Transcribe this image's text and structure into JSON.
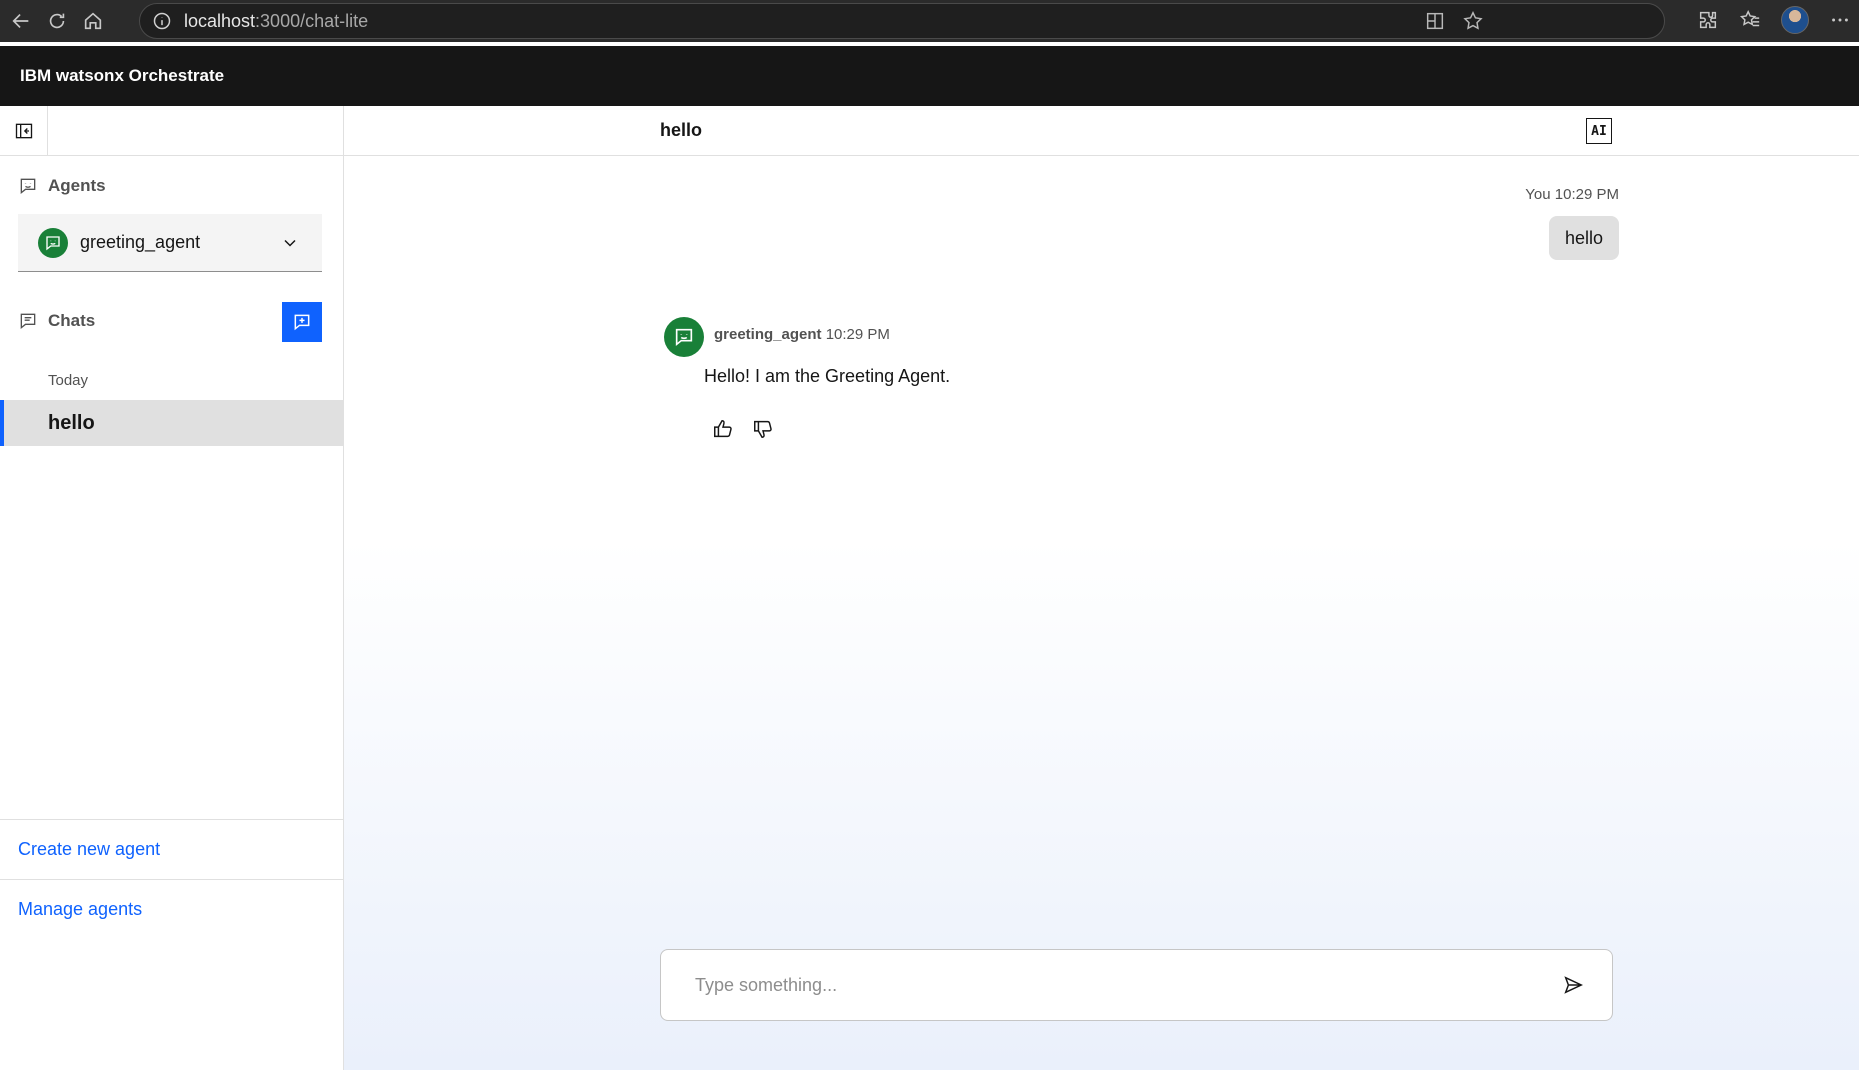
{
  "browser": {
    "url_host": "localhost",
    "url_path": ":3000/chat-lite"
  },
  "app": {
    "title": "IBM watsonx Orchestrate"
  },
  "sidebar": {
    "agents_label": "Agents",
    "selected_agent": "greeting_agent",
    "chats_label": "Chats",
    "group_label": "Today",
    "chats": [
      {
        "title": "hello",
        "selected": true
      }
    ],
    "create_agent_link": "Create new agent",
    "manage_agents_link": "Manage agents"
  },
  "conversation": {
    "title": "hello",
    "ai_badge": "AI",
    "user_message": {
      "sender": "You",
      "time": "10:29 PM",
      "text": "hello"
    },
    "agent_message": {
      "sender": "greeting_agent",
      "time": "10:29 PM",
      "text": "Hello! I am the Greeting Agent."
    }
  },
  "composer": {
    "placeholder": "Type something..."
  },
  "colors": {
    "accent": "#0f62fe",
    "agent_green": "#198038",
    "header_bg": "#161616"
  }
}
